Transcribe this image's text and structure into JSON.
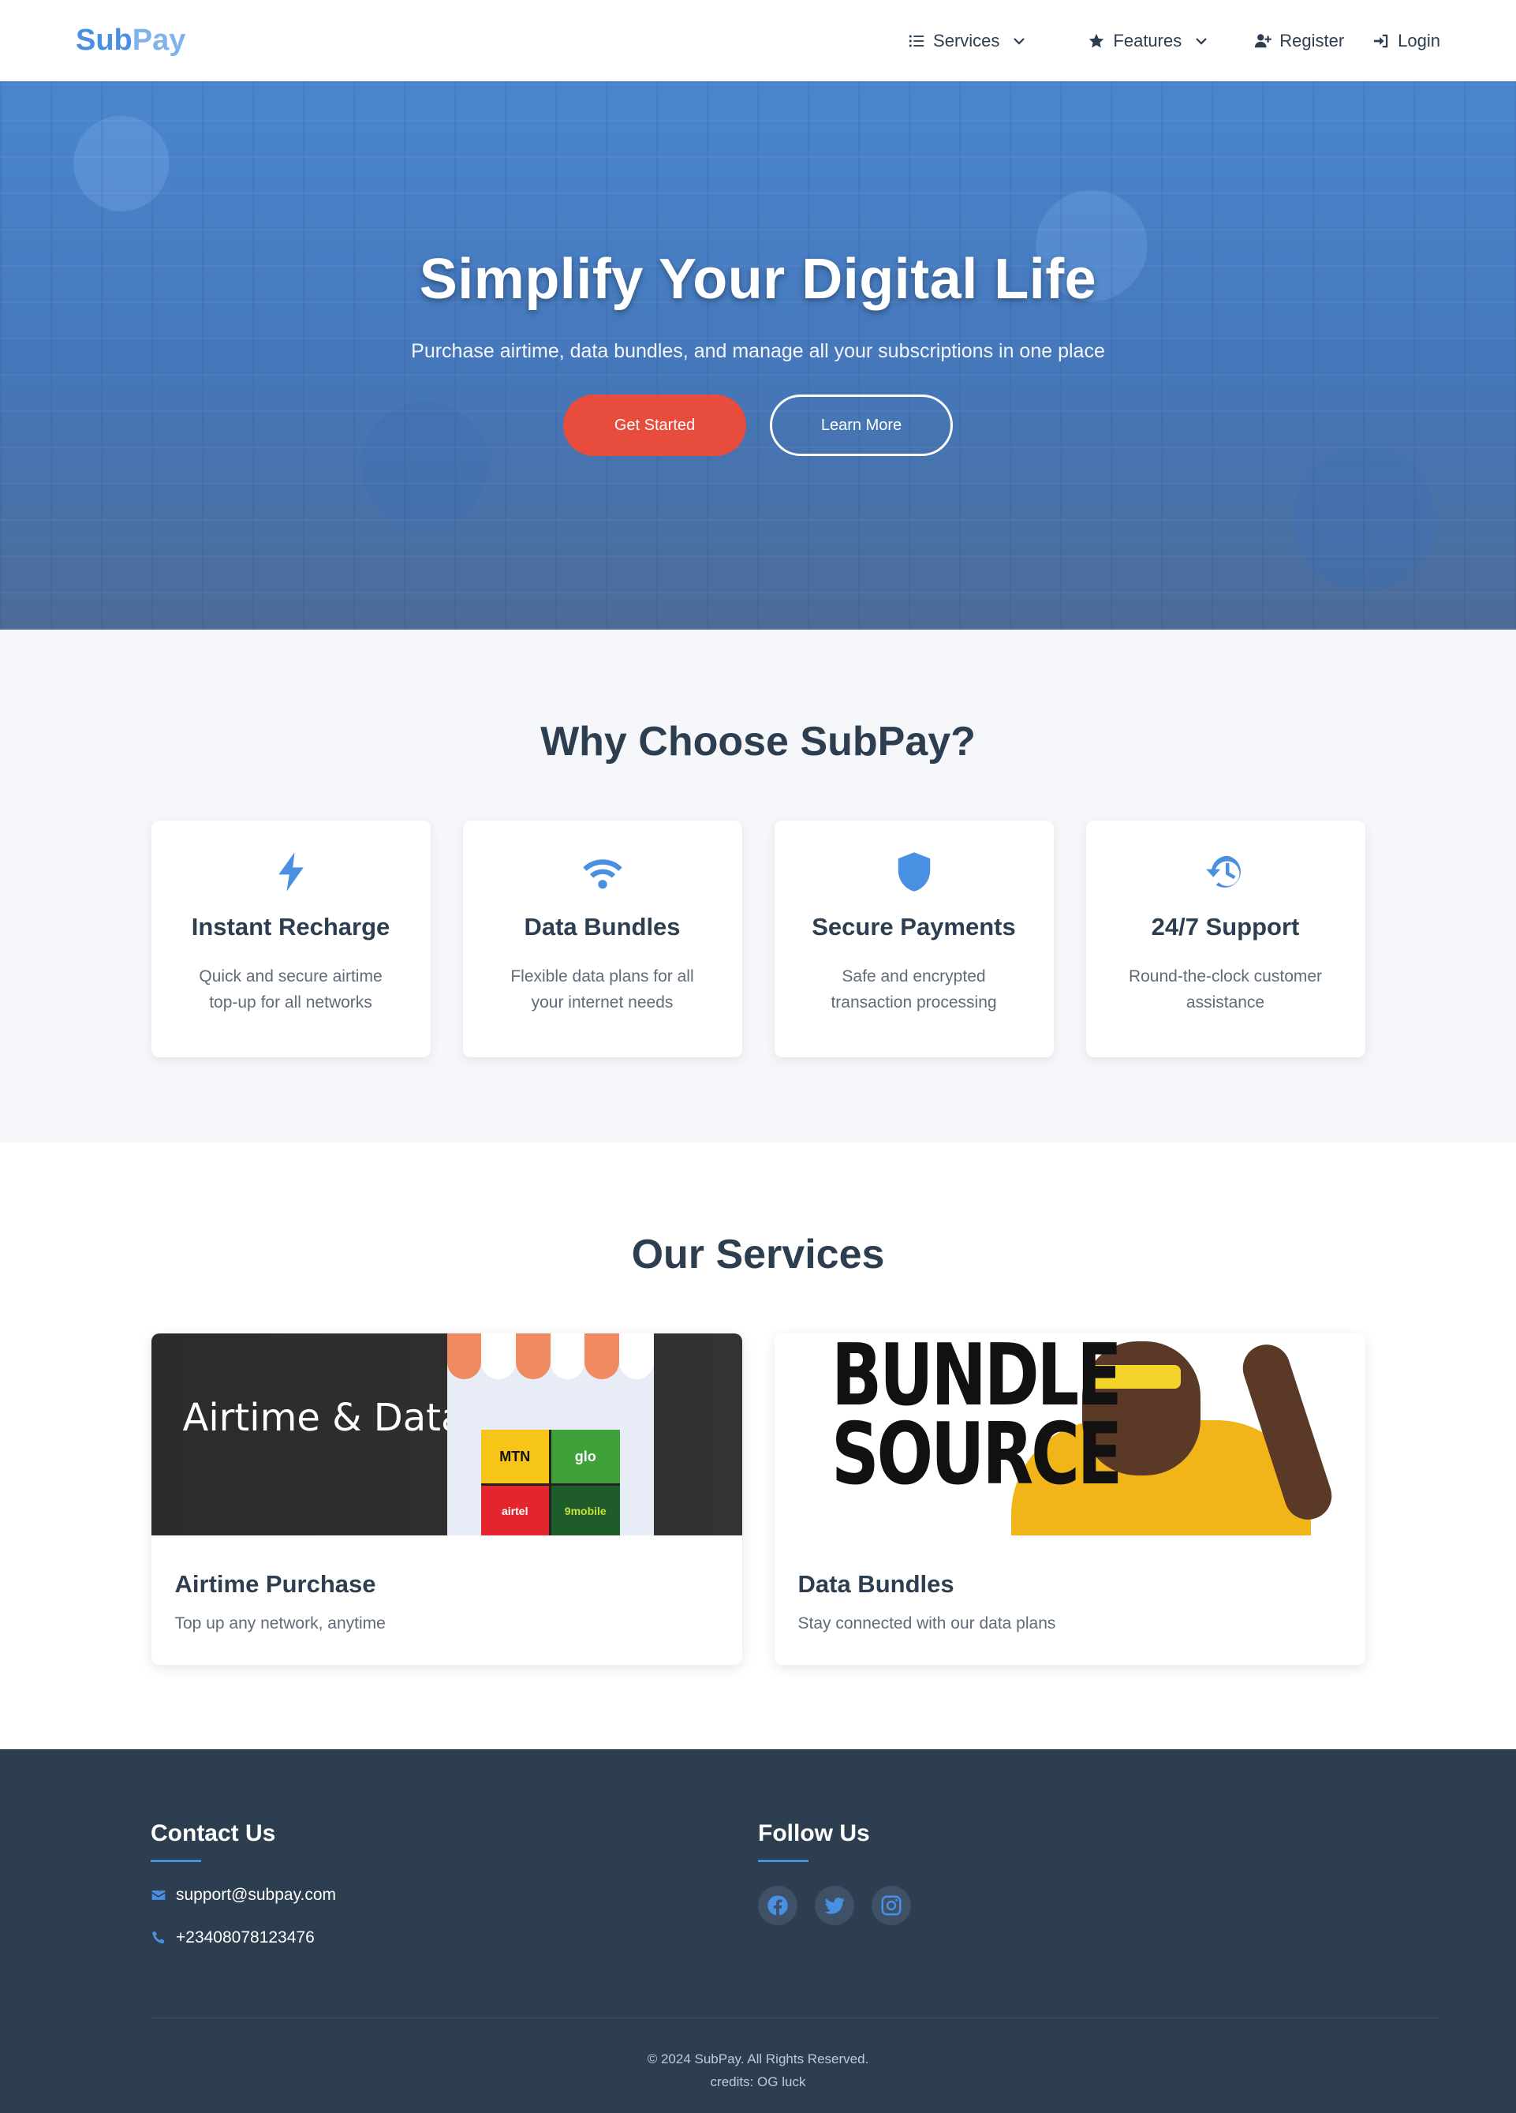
{
  "navbar": {
    "brand_part1": "Sub",
    "brand_part2": "Pay",
    "services_label": "Services",
    "features_label": "Features",
    "register_label": "Register",
    "login_label": "Login"
  },
  "hero": {
    "title": "Simplify Your Digital Life",
    "subtitle": "Purchase airtime, data bundles, and manage all your subscriptions in one place",
    "primary_button": "Get Started",
    "secondary_button": "Learn More"
  },
  "why": {
    "title": "Why Choose SubPay?",
    "features": [
      {
        "icon": "bolt-icon",
        "title": "Instant Recharge",
        "text": "Quick and secure airtime top-up for all networks"
      },
      {
        "icon": "wifi-icon",
        "title": "Data Bundles",
        "text": "Flexible data plans for all your internet needs"
      },
      {
        "icon": "shield-icon",
        "title": "Secure Payments",
        "text": "Safe and encrypted transaction processing"
      },
      {
        "icon": "history-icon",
        "title": "24/7 Support",
        "text": "Round-the-clock customer assistance"
      }
    ]
  },
  "services": {
    "title": "Our Services",
    "items": [
      {
        "title": "Airtime Purchase",
        "text": "Top up any network, anytime",
        "image_text": "Airtime & Data",
        "networks": [
          "MTN",
          "glo",
          "airtel",
          "9mobile"
        ]
      },
      {
        "title": "Data Bundles",
        "text": "Stay connected with our data plans",
        "image_text": "BUNDLE SOURCE"
      }
    ]
  },
  "footer": {
    "contact_title": "Contact Us",
    "email": "support@subpay.com",
    "phone": "+23408078123476",
    "follow_title": "Follow Us",
    "socials": [
      "facebook-icon",
      "twitter-icon",
      "instagram-icon"
    ],
    "copyright": "© 2024 SubPay. All Rights Reserved.",
    "credits": "credits: OG luck"
  },
  "colors": {
    "primary": "#4a90e2",
    "accent": "#e74c3c",
    "dark": "#2c3e50",
    "light_bg": "#f5f7fa"
  }
}
